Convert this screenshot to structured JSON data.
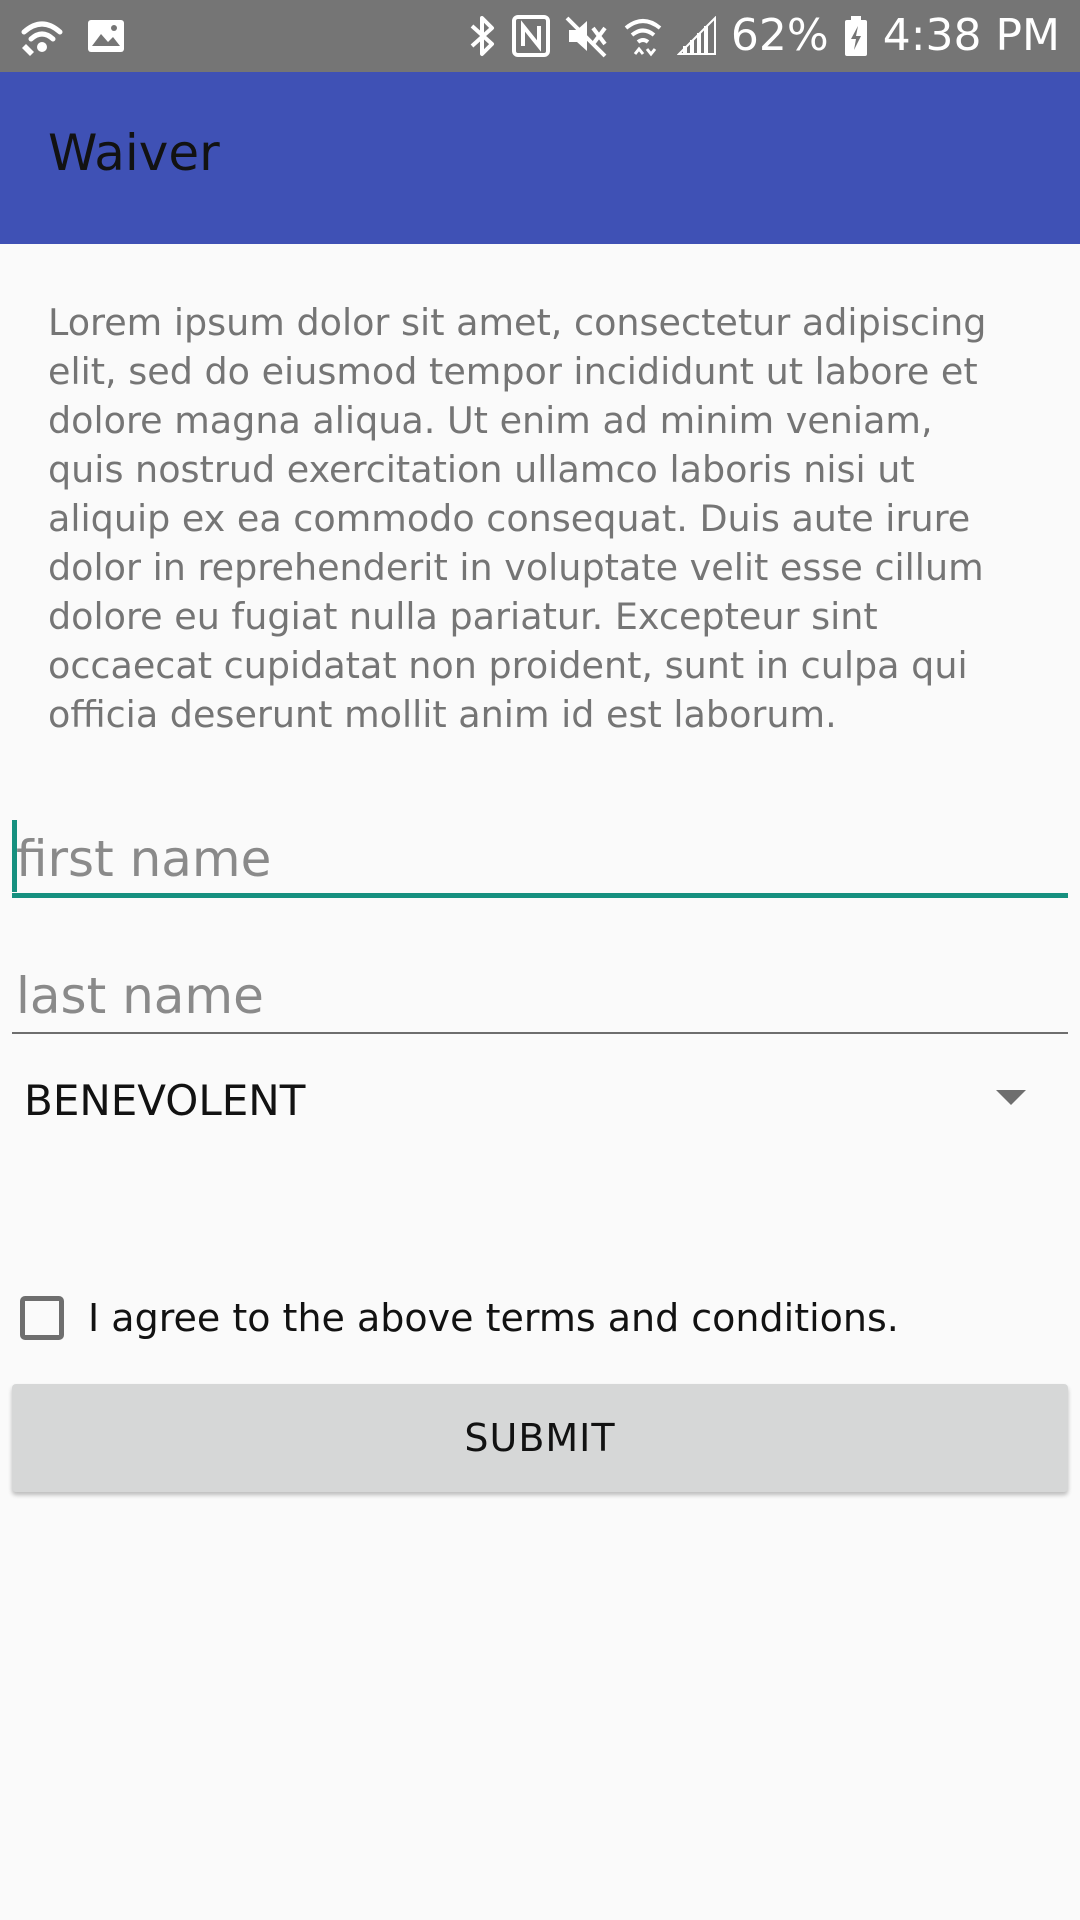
{
  "status_bar": {
    "left_icons": [
      "wifi-call-icon",
      "image-icon"
    ],
    "right_icons": [
      "bluetooth-icon",
      "nfc-icon",
      "mute-icon",
      "wifi-icon",
      "signal-icon"
    ],
    "battery_percent": "62%",
    "time": "4:38 PM",
    "battery_icon": "battery-charging-icon"
  },
  "app_bar": {
    "title": "Waiver",
    "color": "#3F51B5"
  },
  "terms": {
    "text": "Lorem ipsum dolor sit amet, consectetur adipiscing elit, sed do eiusmod tempor incididunt ut labore et dolore magna aliqua. Ut enim ad minim veniam, quis nostrud exercitation ullamco laboris nisi ut aliquip ex ea commodo consequat. Duis aute irure dolor in reprehenderit in voluptate velit esse cillum dolore eu fugiat nulla pariatur. Excepteur sint occaecat cupidatat non proident, sunt in culpa qui officia deserunt mollit anim id est laborum."
  },
  "form": {
    "first_name": {
      "value": "",
      "placeholder": "first name",
      "focused": true
    },
    "last_name": {
      "value": "",
      "placeholder": "last name"
    },
    "spinner": {
      "selected": "BENEVOLENT"
    },
    "checkbox": {
      "label": "I agree to the above terms and conditions.",
      "checked": false
    },
    "submit_label": "SUBMIT",
    "accent_color": "#16907F"
  }
}
